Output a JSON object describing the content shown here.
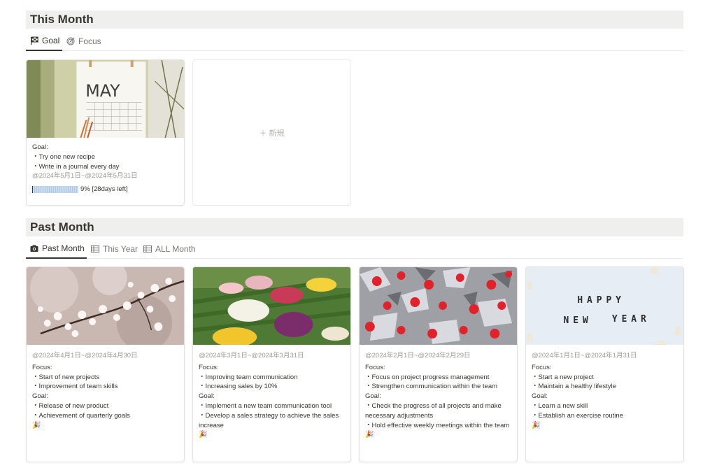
{
  "this_month": {
    "title": "This Month",
    "tabs": [
      {
        "label": "Goal",
        "icon": "checkered-flag-icon"
      },
      {
        "label": "Focus",
        "icon": "target-icon"
      }
    ],
    "card": {
      "image_text": "MAY",
      "goal_label": "Goal:",
      "goals": [
        "・Try one new recipe",
        "・Write in a journal every day"
      ],
      "date": "@2024年5月1日~@2024年5月31日",
      "progress_percent": 9,
      "progress_text": "9% [28days left]"
    },
    "new_label": "新規"
  },
  "past_month": {
    "title": "Past Month",
    "tabs": [
      {
        "label": "Past Month",
        "icon": "camera-icon"
      },
      {
        "label": "This Year",
        "icon": "table-icon"
      },
      {
        "label": "ALL Month",
        "icon": "table-icon"
      }
    ],
    "cards": [
      {
        "date": "@2024年4月1日~@2024年4月30日",
        "focus_label": "Focus:",
        "focus": [
          "・Start of new projects",
          "・Improvement of team skills"
        ],
        "goal_label": "Goal:",
        "goals": [
          "・Release of new product",
          "・Achievement of quarterly goals"
        ],
        "emoji": "🎉"
      },
      {
        "date": "@2024年3月1日~@2024年3月31日",
        "focus_label": "Focus:",
        "focus": [
          "・Improving team communication",
          "・Increasing sales by 10%"
        ],
        "goal_label": "Goal:",
        "goals": [
          "・Implement a new team communication tool",
          "・Develop a sales strategy to achieve the sales increase"
        ],
        "emoji": "🎉"
      },
      {
        "date": "@2024年2月1日~@2024年2月29日",
        "focus_label": "Focus:",
        "focus": [
          "・Focus on project progress management",
          "・Strengthen communication within the team"
        ],
        "goal_label": "Goal:",
        "goals": [
          "・Check the progress of all projects and make necessary adjustments",
          "・Hold effective weekly meetings within the team"
        ],
        "emoji": "🎉"
      },
      {
        "date": "@2024年1月1日~@2024年1月31日",
        "focus_label": "Focus:",
        "focus": [
          "・Start a new project",
          "・Maintain a healthy lifestyle"
        ],
        "goal_label": "Goal:",
        "goals": [
          "・Learn a new skill",
          "・Establish an exercise routine"
        ],
        "emoji": "🎉"
      }
    ],
    "ny_tiles": [
      "HAPPY",
      "NEW",
      "YEAR"
    ]
  },
  "colors": {
    "header_bg": "#efefed",
    "text": "#37352f",
    "muted": "#9b9a97",
    "progress": "#aec8e6"
  }
}
